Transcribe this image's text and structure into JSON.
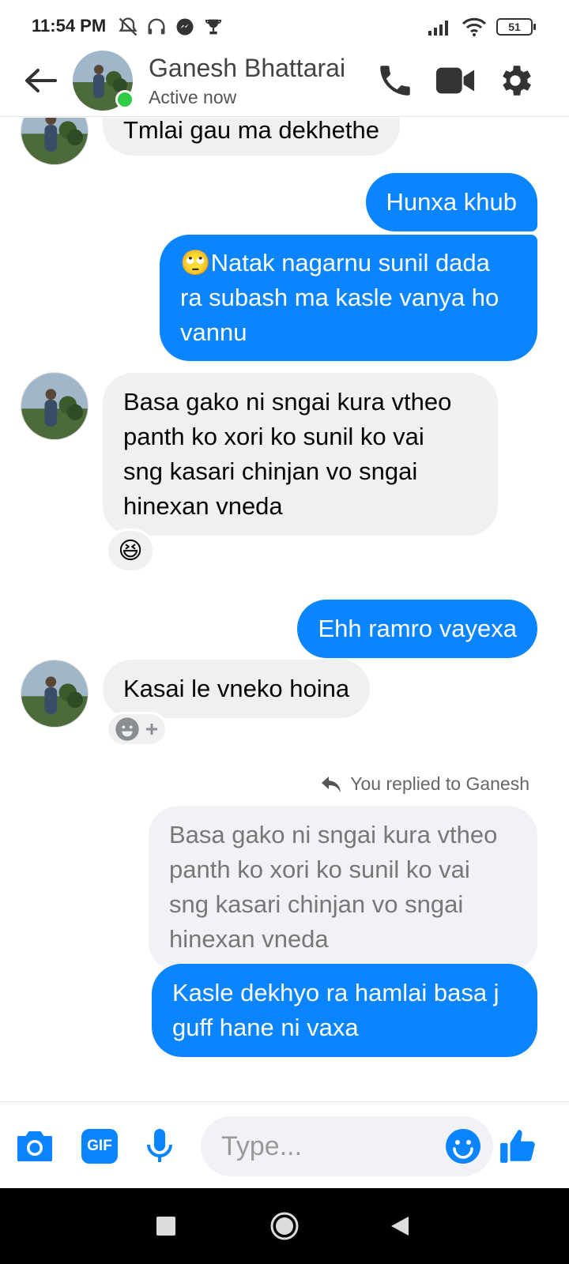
{
  "status_bar": {
    "time": "11:54 PM",
    "battery": "51"
  },
  "header": {
    "contact_name": "Ganesh Bhattarai",
    "contact_status": "Active now"
  },
  "messages": [
    {
      "dir": "in",
      "lines": [
        "Tmlai gau ma dekhethe"
      ]
    },
    {
      "dir": "out",
      "lines": [
        "Hunxa khub"
      ]
    },
    {
      "dir": "out",
      "lines": [
        "🙄Natak nagarnu sunil dada",
        "ra subash ma kasle vanya ho",
        "vannu"
      ]
    },
    {
      "dir": "in",
      "lines": [
        "Basa gako ni sngai kura vtheo",
        "panth ko xori ko sunil ko vai",
        "sng kasari chinjan vo sngai",
        "hinexan vneda"
      ],
      "reaction": "😆"
    },
    {
      "dir": "out",
      "lines": [
        "Ehh ramro vayexa"
      ]
    },
    {
      "dir": "in",
      "lines": [
        "Kasai le vneko hoina"
      ]
    },
    {
      "dir": "out",
      "reply_note": "You replied to Ganesh",
      "quoted_lines": [
        "Basa gako ni sngai kura vtheo",
        "panth ko xori ko sunil ko vai",
        "sng kasari chinjan vo sngai",
        "hinexan vneda"
      ],
      "lines": [
        "Kasle dekhyo ra hamlai basa j",
        "guff hane ni vaxa"
      ]
    }
  ],
  "composer": {
    "placeholder": "Type...",
    "gif_label": "GIF"
  },
  "colors": {
    "accent": "#0a84ff",
    "incoming_bubble": "#f0f0f0",
    "online": "#31cc46"
  }
}
